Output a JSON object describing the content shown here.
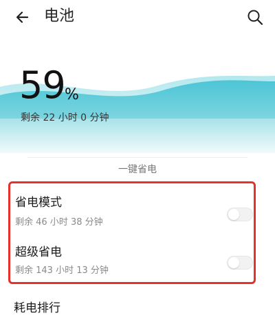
{
  "header": {
    "back_icon": "arrow-left-icon",
    "title": "电池",
    "search_icon": "search-icon"
  },
  "battery": {
    "percent": "59",
    "percent_sign": "%",
    "remaining": "剩余 22 小时 0 分钟",
    "level_fraction": 0.59,
    "wave_color": "#4fc3d6"
  },
  "section": {
    "label": "一键省电"
  },
  "settings": [
    {
      "title": "省电模式",
      "subtitle": "剩余 46 小时 38 分钟",
      "enabled": false
    },
    {
      "title": "超级省电",
      "subtitle": "剩余 143 小时 13 分钟",
      "enabled": false
    }
  ],
  "usage": {
    "title": "耗电排行"
  },
  "colors": {
    "highlight": "#e4322b",
    "accent": "#4fc3d6"
  }
}
